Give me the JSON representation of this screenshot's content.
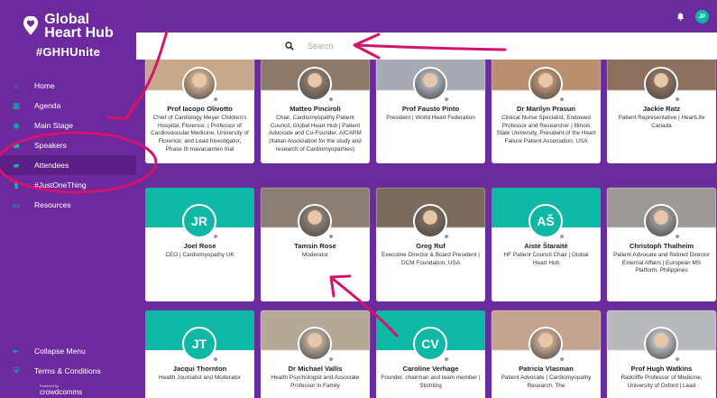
{
  "brand": {
    "title_line1": "Global",
    "title_line2": "Heart Hub",
    "hashtag": "#GHHUnite",
    "powered_by": "Powered by",
    "footer_logo": "crowdcomms"
  },
  "sidebar": {
    "items": [
      {
        "label": "Home",
        "icon": "home-icon"
      },
      {
        "label": "Agenda",
        "icon": "calendar-icon"
      },
      {
        "label": "Main Stage",
        "icon": "play-icon"
      },
      {
        "label": "Speakers",
        "icon": "people-icon"
      },
      {
        "label": "Attendees",
        "icon": "chat-icon"
      },
      {
        "label": "#JustOneThing",
        "icon": "book-icon"
      },
      {
        "label": "Resources",
        "icon": "folder-icon"
      }
    ],
    "bottom": [
      {
        "label": "Collapse Menu",
        "icon": "collapse-icon"
      },
      {
        "label": "Terms & Conditions",
        "icon": "shield-icon"
      }
    ]
  },
  "topbar": {
    "user_initials": "JP"
  },
  "search": {
    "placeholder": "Search"
  },
  "cards": [
    {
      "name": "Prof Iacopo Olivotto",
      "title": "Chief of Cardiology Meyer Children's Hospital, Florence; | Professor of Cardiovascular Medicine, University of Florence; and Lead Investigator, Phase III mavacamten trial",
      "type": "photo",
      "banner": "#c7a88a"
    },
    {
      "name": "Matteo Pinciroli",
      "title": "Chair, Cardiomyopathy Patient Council, Global Heart Hub | Patient Advocate and Co-Founder, AICARM (Italian Association for the study and research of Cardiomyopathies)",
      "type": "photo",
      "banner": "#8d7a6a"
    },
    {
      "name": "Prof Fausto Pinto",
      "title": "President | World Heart Federation",
      "type": "photo",
      "banner": "#a7a9b5"
    },
    {
      "name": "Dr Marilyn Prasun",
      "title": "Clinical Nurse Specialist, Endowed Professor and Researcher | Illinois State University, President of the Heart Failure Patient Association, USA",
      "type": "photo",
      "banner": "#b98f70"
    },
    {
      "name": "Jackie Ratz",
      "title": "Patient Representative | HeartLife Canada",
      "type": "photo",
      "banner": "#8c6f5f"
    },
    {
      "name": "Joel Rose",
      "title": "CEO | Cardiomyopathy UK",
      "type": "initials",
      "initials": "JR"
    },
    {
      "name": "Tamsin Rose",
      "title": "Moderator",
      "type": "photo",
      "banner": "#8a7e75"
    },
    {
      "name": "Greg Ruf",
      "title": "Executive Director & Board President | DCM Foundation, USA",
      "type": "photo",
      "banner": "#7b6a5e"
    },
    {
      "name": "Aistė Štaraitė",
      "title": "HF Patient Council Chair | Global Heart Hub",
      "type": "initials",
      "initials": "AŠ"
    },
    {
      "name": "Christoph Thalheim",
      "title": "Patient Advocate and Retired Director External Affairs | European MS Platform, Philippines",
      "type": "photo",
      "banner": "#9b9a97"
    },
    {
      "name": "Jacqui Thornton",
      "title": "Health Journalist and Moderator",
      "type": "initials",
      "initials": "JT"
    },
    {
      "name": "Dr Michael Vallis",
      "title": "Health Psychologist and Associate Professor in Family",
      "type": "photo",
      "banner": "#b6a896"
    },
    {
      "name": "Caroline Verhage",
      "title": "Founder, chairman and team member | Stichting",
      "type": "initials",
      "initials": "CV"
    },
    {
      "name": "Patricia Vlasman",
      "title": "Patient Advocate | Cardiomyopathy Research, The",
      "type": "photo",
      "banner": "#c3a58f"
    },
    {
      "name": "Prof Hugh Watkins",
      "title": "Radcliffe Professor of Medicine, University of Oxford | Lead",
      "type": "photo",
      "banner": "#b7b9bc"
    }
  ]
}
